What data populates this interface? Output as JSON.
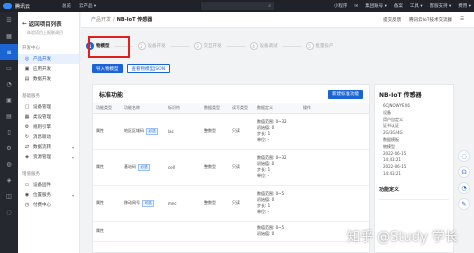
{
  "topbar": {
    "brand": "腾讯云",
    "nav": [
      "总览",
      "云产品 ▾"
    ],
    "search_icon": "search-icon",
    "right": [
      "小程序",
      "✉",
      "集团账号 ▾",
      "备案",
      "工具 ▾",
      "客服支持 ▾",
      "费用 ▾"
    ]
  },
  "rail": {
    "icons": [
      "menu-icon",
      "grid-icon",
      "list-icon",
      "card-icon",
      "user-icon",
      "box-icon",
      "chart-icon",
      "doc-icon",
      "gear-icon",
      "bell-icon",
      "shield-icon",
      "layers-icon",
      "chat-icon"
    ]
  },
  "sidebar": {
    "back_label": "返回项目列表",
    "back_sub": "体验项目上报联调目",
    "groups": [
      {
        "title": "开发中心",
        "items": [
          {
            "label": "产品开发",
            "icon": "◎",
            "active": true
          },
          {
            "label": "应用开发",
            "icon": "▣"
          },
          {
            "label": "数据开发",
            "icon": "▤"
          }
        ]
      },
      {
        "title": "基础服务",
        "items": [
          {
            "label": "设备管理",
            "icon": "▢"
          },
          {
            "label": "类设管理",
            "icon": "▦"
          },
          {
            "label": "规则引擎",
            "icon": "⚙"
          },
          {
            "label": "消息联动",
            "icon": "↻"
          },
          {
            "label": "数据流转",
            "icon": "⇄",
            "chev": "▾"
          },
          {
            "label": "资源管理",
            "icon": "◈",
            "chev": "▾"
          }
        ]
      },
      {
        "title": "增值服务",
        "items": [
          {
            "label": "设备固件",
            "icon": "▭"
          },
          {
            "label": "位置服务",
            "icon": "◉",
            "chev": "▾"
          },
          {
            "label": "付费中心",
            "icon": "◷"
          }
        ]
      }
    ]
  },
  "breadcrumb": {
    "parent": "产品开发",
    "separator": "/",
    "current": "NB-IoT 传感器",
    "links": [
      "提交反馈",
      "腾讯云IoT技术交流群",
      "☰"
    ]
  },
  "steps": [
    {
      "num": "1",
      "label": "物模型",
      "active": true
    },
    {
      "num": "2",
      "label": "设备开发"
    },
    {
      "num": "3",
      "label": "交互开发"
    },
    {
      "num": "4",
      "label": "设备调试"
    },
    {
      "num": "5",
      "label": "批量投产"
    }
  ],
  "actions": {
    "import": "导入物模型",
    "view_json": "查看物模型JSON"
  },
  "features": {
    "title": "标准功能",
    "add_label": "新建标准功能",
    "columns": [
      "功能类型",
      "功能名称",
      "标识符",
      "数据类型",
      "读写类型",
      "数据定义",
      "操作"
    ],
    "rows": [
      {
        "type": "属性",
        "name": "地区区域码",
        "required": "必选",
        "id": "lac",
        "dtype": "整数型",
        "rw": "只读",
        "def": [
          "数值范围: 0~32",
          "初始值: 0",
          "步长: 1",
          "单位: -"
        ],
        "op": ""
      },
      {
        "type": "属性",
        "name": "基站码",
        "required": "必选",
        "id": "cell",
        "dtype": "整数型",
        "rw": "只读",
        "def": [
          "数值范围: 0~32",
          "初始值: 0",
          "步长: 1",
          "单位: -"
        ],
        "op": ""
      },
      {
        "type": "属性",
        "name": "移动网号",
        "required": "可选",
        "id": "mnc",
        "dtype": "整数型",
        "rw": "只读",
        "def": [
          "数值范围: 0~5",
          "初始值: 0",
          "步长: 1",
          "单位: -"
        ],
        "op": ""
      },
      {
        "type": "属性",
        "name": "",
        "required": "",
        "id": "",
        "dtype": "",
        "rw": "",
        "def": [
          "数值范围: 0~5",
          "初始值: 0"
        ],
        "op": ""
      }
    ]
  },
  "detail": {
    "title": "NB-IoT 传感器",
    "values": [
      "6CJNOWYEX6",
      "设备",
      "用户自定义",
      "证书认证",
      "2G/3G/4G",
      "数据模板",
      "物模型",
      "2022-06-15",
      "14:43:21",
      "2022-06-15",
      "14:43:21"
    ],
    "section": "功能定义"
  },
  "floaters": [
    "chat-icon",
    "headset-icon",
    "user-icon",
    "edit-icon"
  ],
  "watermark": "知乎 @Study 学长"
}
